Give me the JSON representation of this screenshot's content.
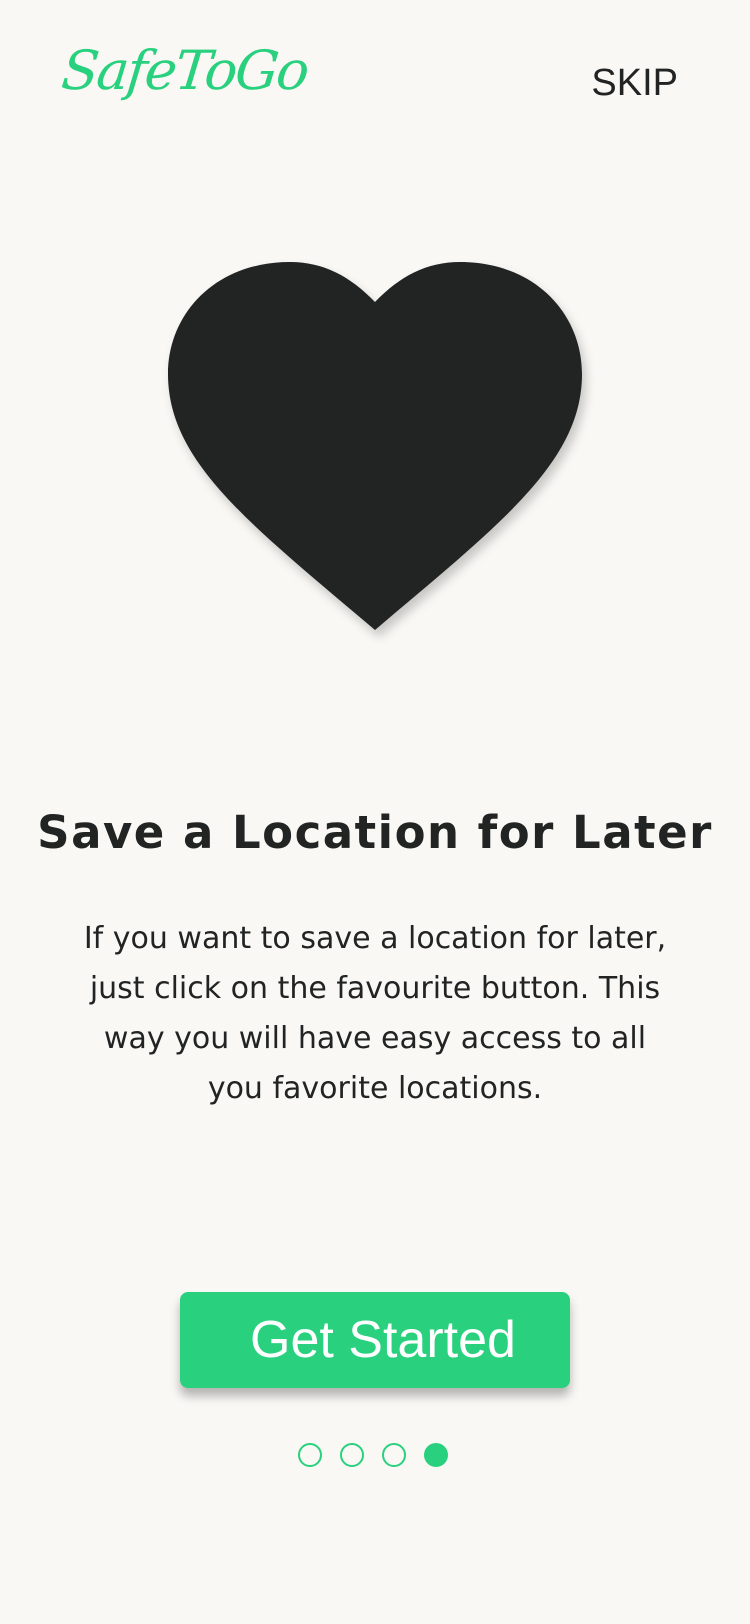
{
  "header": {
    "logo_text": "SafeToGo",
    "skip_label": "SKIP"
  },
  "illustration": {
    "icon": "heart-icon"
  },
  "content": {
    "title": "Save a Location for Later",
    "body": "If you want to save a location for later, just click on the favourite button. This way you will have easy access to all you favorite locations."
  },
  "actions": {
    "get_started_label": "Get Started"
  },
  "pagination": {
    "total": 4,
    "current": 4
  },
  "colors": {
    "accent": "#29d17e",
    "background": "#f9f8f5",
    "text": "#222423"
  }
}
